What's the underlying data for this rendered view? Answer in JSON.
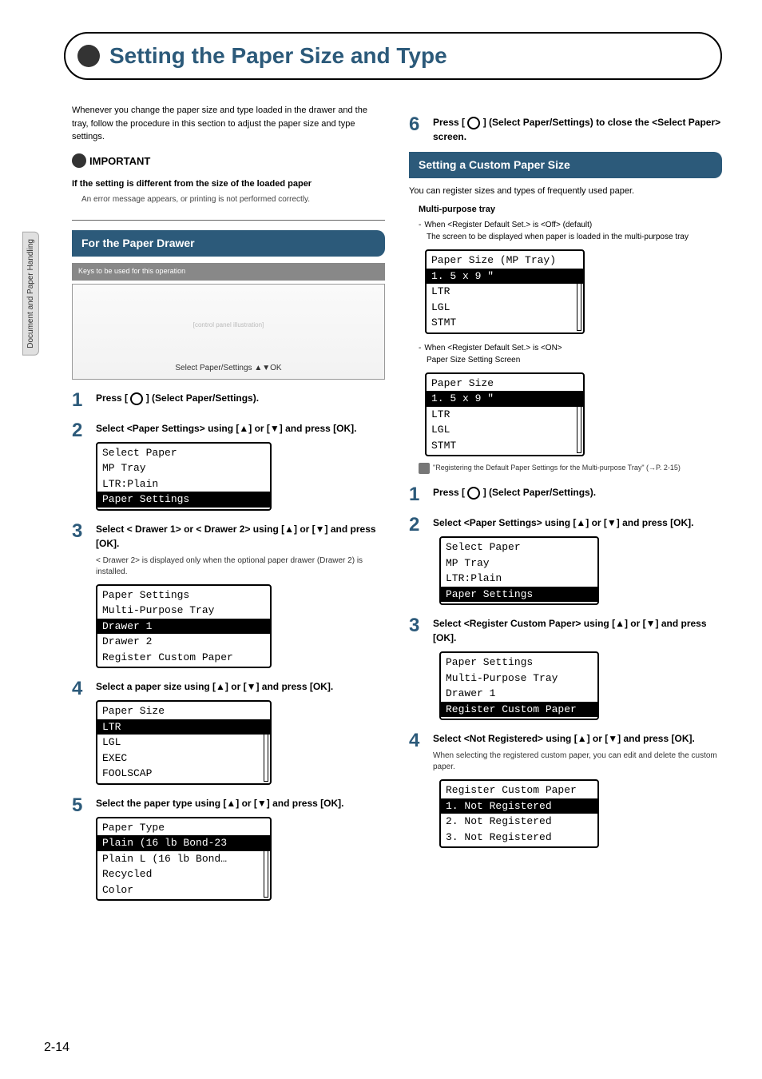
{
  "side_tab": "Document and Paper Handling",
  "page_number": "2-14",
  "title": "Setting the Paper Size and Type",
  "intro": "Whenever you change the paper size and type loaded in the drawer and the tray, follow the procedure in this section to adjust the paper size and type settings.",
  "important": {
    "label": "IMPORTANT",
    "heading": "If the setting is different from the size of the loaded paper",
    "note": "An error message appears, or printing is not performed correctly."
  },
  "left": {
    "section_header": "For the Paper Drawer",
    "keys_label": "Keys to be used for this operation",
    "panel_caption": "Select Paper/Settings     ▲▼OK",
    "step1": "Press [    ] (Select Paper/Settings).",
    "step2": "Select <Paper Settings> using [▲] or [▼] and press [OK].",
    "lcd2": {
      "title": "Select Paper",
      "rows": [
        "  MP Tray",
        "  LTR:Plain"
      ],
      "hl": "Paper Settings"
    },
    "step3": "Select < Drawer 1> or < Drawer 2> using [▲] or [▼] and press [OK].",
    "step3_note": "< Drawer 2> is displayed only when the optional paper drawer (Drawer 2) is installed.",
    "lcd3": {
      "title": "Paper Settings",
      "rows_before": [
        " Multi-Purpose Tray"
      ],
      "hl": " Drawer 1",
      "rows_after": [
        " Drawer 2",
        " Register Custom Paper"
      ]
    },
    "step4": "Select a paper size using [▲] or [▼] and press [OK].",
    "lcd4": {
      "title": "Paper Size",
      "hl": " LTR",
      "rows_after": [
        " LGL",
        " EXEC",
        " FOOLSCAP"
      ]
    },
    "step5": "Select the paper type using [▲] or [▼] and press [OK].",
    "lcd5": {
      "title": "Paper Type",
      "hl": " Plain (16 lb Bond-23",
      "rows_after": [
        " Plain L (16 lb Bond…",
        " Recycled",
        " Color"
      ]
    }
  },
  "right": {
    "step6": "Press [    ]  (Select Paper/Settings) to close the <Select Paper> screen.",
    "section_header": "Setting a Custom Paper Size",
    "intro": "You can register sizes and types of frequently used paper.",
    "mp": {
      "title": "Multi-purpose tray",
      "b1a": "When <Register Default Set.> is <Off> (default)",
      "b1b": "The screen to be displayed when paper is loaded in the multi-purpose tray",
      "lcd_a": {
        "title": "Paper Size (MP Tray)",
        "hl": " 1. 5 x 9 \"",
        "rows_after": [
          " LTR",
          " LGL",
          " STMT"
        ]
      },
      "b2a": "When <Register Default Set.> is <ON>",
      "b2b": "Paper Size Setting Screen",
      "lcd_b": {
        "title": "Paper Size",
        "hl": " 1. 5 x 9 \"",
        "rows_after": [
          " LTR",
          " LGL",
          " STMT"
        ]
      },
      "xref": "\"Registering the Default Paper Settings for the Multi-purpose Tray\" (→P. 2-15)"
    },
    "step1": "Press [    ] (Select Paper/Settings).",
    "step2": "Select <Paper Settings> using [▲] or [▼] and press [OK].",
    "lcd2": {
      "title": "Select Paper",
      "rows": [
        "  MP Tray",
        "  LTR:Plain"
      ],
      "hl": "Paper Settings"
    },
    "step3": "Select <Register Custom Paper> using [▲] or [▼] and press [OK].",
    "lcd3": {
      "title": "Paper Settings",
      "rows_before": [
        " Multi-Purpose Tray",
        " Drawer 1"
      ],
      "hl": " Register Custom Paper"
    },
    "step4": "Select <Not Registered> using [▲] or [▼] and press [OK].",
    "step4_note": "When selecting the registered custom paper, you can edit and delete the custom paper.",
    "lcd4": {
      "title": "Register Custom Paper",
      "hl": " 1. Not Registered",
      "rows_after": [
        " 2. Not Registered",
        " 3. Not Registered"
      ]
    }
  }
}
